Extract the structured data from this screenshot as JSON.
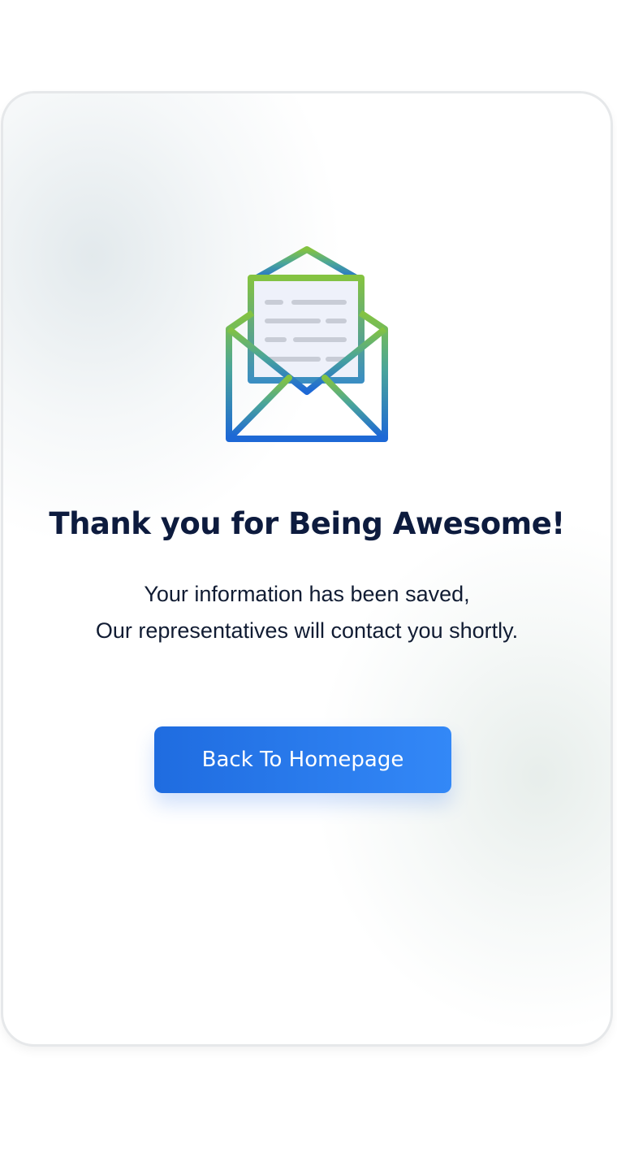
{
  "card": {
    "title": "Thank you for Being Awesome!",
    "message_line1": "Your information has been saved,",
    "message_line2": "Our representatives will contact you shortly.",
    "button_label": "Back To Homepage",
    "icon": "envelope-open-letter-icon"
  },
  "colors": {
    "title": "#0d1b3e",
    "button_start": "#1f6ce0",
    "button_end": "#3388f7",
    "icon_green": "#84c341",
    "icon_blue": "#1d68d6"
  }
}
